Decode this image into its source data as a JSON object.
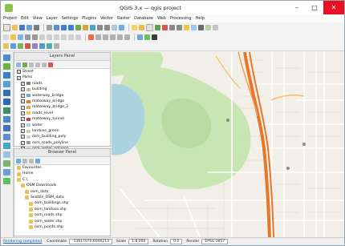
{
  "window": {
    "title": "QGIS 3.x — qgis project"
  },
  "menu": [
    "Project",
    "Edit",
    "View",
    "Layer",
    "Settings",
    "Plugins",
    "Vector",
    "Raster",
    "Database",
    "Web",
    "Processing",
    "Help"
  ],
  "panels": {
    "layers_title": "Layers Panel",
    "browser_title": "Browser Panel"
  },
  "layers": [
    {
      "label": "Street",
      "checked": true,
      "color": ""
    },
    {
      "label": "Parks",
      "checked": true,
      "color": ""
    },
    {
      "label": "roads",
      "checked": true,
      "color": "#808080"
    },
    {
      "label": "building",
      "checked": true,
      "color": "#c9b99a"
    },
    {
      "label": "waterway_bridge",
      "checked": true,
      "color": "#7aa6d6"
    },
    {
      "label": "motorway_bridge",
      "checked": true,
      "color": "#e8762b"
    },
    {
      "label": "motorway_bridge_2",
      "checked": true,
      "color": "#e8a050"
    },
    {
      "label": "roads_level",
      "checked": true,
      "color": "#f4c35a"
    },
    {
      "label": "motorway_tunnel",
      "checked": true,
      "color": "#c94040"
    },
    {
      "label": "water",
      "checked": true,
      "color": "#a8d0ef"
    },
    {
      "label": "landuse_green",
      "checked": true,
      "color": "#b5dc9f"
    },
    {
      "label": "osm_building_poly",
      "checked": true,
      "color": "#d7cfc0"
    },
    {
      "label": "osm_roads_polyline",
      "checked": true,
      "color": "#9a9a9a"
    },
    {
      "label": "osm_water_polygon",
      "checked": true,
      "color": "#8fc1e8"
    }
  ],
  "browser": [
    {
      "label": "Favourites",
      "indent": 0
    },
    {
      "label": "Home",
      "indent": 0
    },
    {
      "label": "C:\\",
      "indent": 0
    },
    {
      "label": "OSM Downloads",
      "indent": 1
    },
    {
      "label": "osm_data",
      "indent": 2
    },
    {
      "label": "Seattle_OSM_data",
      "indent": 2
    },
    {
      "label": "osm_buildings.shp",
      "indent": 3
    },
    {
      "label": "osm_landuse.shp",
      "indent": 3
    },
    {
      "label": "osm_roads.shp",
      "indent": 3
    },
    {
      "label": "osm_water.shp",
      "indent": 3
    },
    {
      "label": "osm_points.shp",
      "indent": 3
    }
  ],
  "status": {
    "message": "Rendering completed",
    "coordinate_label": "Coordinate",
    "coordinate_value": "-13617070,6046213",
    "scale_label": "Scale",
    "scale_value": "1:8,000",
    "rotation_label": "Rotation",
    "rotation_value": "0.0",
    "render_label": "Render",
    "crs_value": "EPSG:3857"
  },
  "map": {
    "water_color": "#aad3df",
    "park_color": "#c8e6b4",
    "background_color": "#f2efe9",
    "motorway_color": "#e8762b"
  }
}
